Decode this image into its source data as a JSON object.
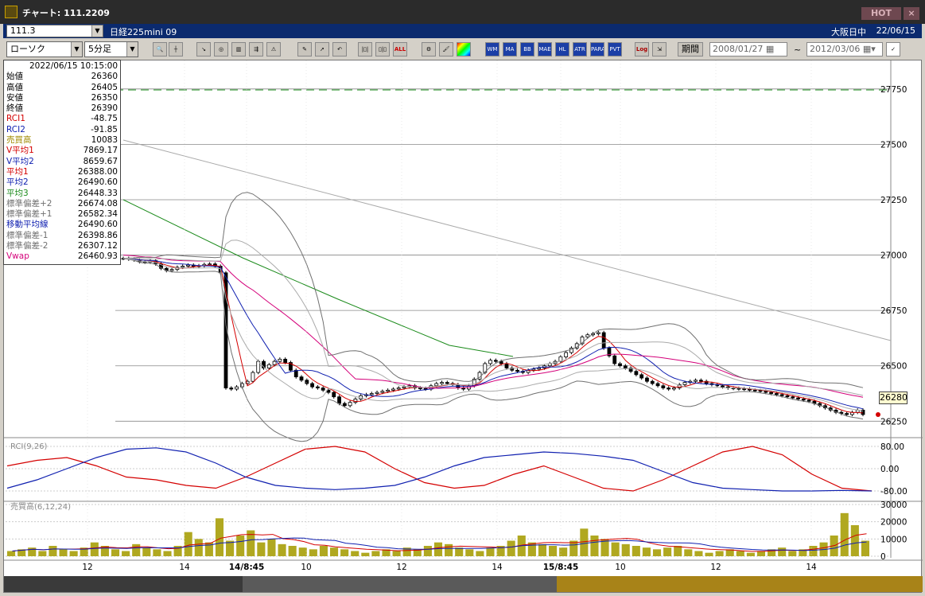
{
  "window": {
    "title": "チャート: 111.2209",
    "hot_label": "HOT"
  },
  "header": {
    "code": "111.3",
    "instrument": "日経225mini 09",
    "market": "大阪日中",
    "date": "22/06/15"
  },
  "toolbar": {
    "chart_type": "ローソク",
    "interval": "5分足",
    "buttons": [
      "zoom",
      "cursor",
      "draw-a",
      "draw-b",
      "draw-c",
      "draw-d",
      "draw-e",
      "pen",
      "arrow",
      "undo",
      "sep-a",
      "sep-b",
      "all",
      "gear",
      "brush",
      "palette",
      "WM",
      "MA",
      "BB",
      "MAE",
      "HL",
      "ATR",
      "PARA",
      "PVT",
      "Log",
      "export"
    ],
    "btn_labels": {
      "all": "ALL",
      "wm": "WM",
      "ma": "MA",
      "bb": "BB",
      "mae": "MAE",
      "hl": "HL",
      "atr": "ATR",
      "para": "PARA",
      "pvt": "PVT",
      "log": "Log"
    },
    "period_label": "期間",
    "date_from": "2008/01/27",
    "tilde": "~",
    "date_to": "2012/03/06"
  },
  "info": {
    "timestamp": "2022/06/15 10:15:00",
    "rows": [
      {
        "label": "始値",
        "value": "26360",
        "color": "#000000"
      },
      {
        "label": "高値",
        "value": "26405",
        "color": "#000000"
      },
      {
        "label": "安値",
        "value": "26350",
        "color": "#000000"
      },
      {
        "label": "終値",
        "value": "26390",
        "color": "#000000"
      },
      {
        "label": "RCI1",
        "value": "-48.75",
        "color": "#d40000"
      },
      {
        "label": "RCI2",
        "value": "-91.85",
        "color": "#1020b0"
      },
      {
        "label": "売買高",
        "value": "10083",
        "color": "#a08a00"
      },
      {
        "label": "V平均1",
        "value": "7869.17",
        "color": "#d40000"
      },
      {
        "label": "V平均2",
        "value": "8659.67",
        "color": "#1020b0"
      },
      {
        "label": "平均1",
        "value": "26388.00",
        "color": "#d40000"
      },
      {
        "label": "平均2",
        "value": "26490.60",
        "color": "#1020b0"
      },
      {
        "label": "平均3",
        "value": "26448.33",
        "color": "#1a8a1a"
      },
      {
        "label": "標準偏差+2",
        "value": "26674.08",
        "color": "#707070"
      },
      {
        "label": "標準偏差+1",
        "value": "26582.34",
        "color": "#707070"
      },
      {
        "label": "移動平均線",
        "value": "26490.60",
        "color": "#1020b0"
      },
      {
        "label": "標準偏差-1",
        "value": "26398.86",
        "color": "#707070"
      },
      {
        "label": "標準偏差-2",
        "value": "26307.12",
        "color": "#707070"
      },
      {
        "label": "Vwap",
        "value": "26460.93",
        "color": "#d4007a"
      }
    ]
  },
  "price_axis": {
    "ticks": [
      "27750",
      "27500",
      "27250",
      "27000",
      "26750",
      "26500",
      "26250"
    ]
  },
  "rci_axis": {
    "label": "RCI(9,26)",
    "ticks": [
      "80.00",
      "0.00",
      "-80.00"
    ]
  },
  "vol_axis": {
    "label": "売買高(6,12,24)",
    "ticks": [
      "30000",
      "20000",
      "10000",
      "0"
    ]
  },
  "time_axis": {
    "labels": [
      "12",
      "14",
      "14/8:45",
      "10",
      "12",
      "14",
      "15/8:45",
      "10",
      "12",
      "14"
    ]
  },
  "current_price": "26280",
  "colors": {
    "candle_up": "#ffffff",
    "candle_down": "#000000",
    "ma1": "#d40000",
    "ma2": "#1020b0",
    "ma3": "#1a8a1a",
    "bb": "#707070",
    "vwap": "#d4007a",
    "volume": "#b0a820"
  },
  "chart_data": {
    "type": "candlestick",
    "price_ylim": [
      26190,
      27850
    ],
    "candles_close": [
      26985,
      26982,
      26978,
      26970,
      26968,
      26975,
      26960,
      26940,
      26930,
      26935,
      26945,
      26950,
      26955,
      26948,
      26952,
      26958,
      26960,
      26950,
      26920,
      26400,
      26395,
      26405,
      26420,
      26430,
      26470,
      26520,
      26490,
      26505,
      26520,
      26530,
      26515,
      26480,
      26450,
      26435,
      26420,
      26405,
      26400,
      26390,
      26380,
      26360,
      26330,
      26320,
      26335,
      26350,
      26365,
      26370,
      26375,
      26380,
      26385,
      26390,
      26395,
      26400,
      26405,
      26410,
      26400,
      26398,
      26395,
      26410,
      26420,
      26425,
      26420,
      26415,
      26400,
      26395,
      26410,
      26440,
      26470,
      26510,
      26525,
      26520,
      26510,
      26490,
      26480,
      26475,
      26470,
      26480,
      26485,
      26490,
      26500,
      26510,
      26520,
      26540,
      26560,
      26580,
      26600,
      26630,
      26640,
      26645,
      26650,
      26580,
      26545,
      26510,
      26500,
      26490,
      26475,
      26460,
      26445,
      26430,
      26420,
      26410,
      26400,
      26395,
      26400,
      26415,
      26425,
      26430,
      26435,
      26430,
      26420,
      26415,
      26410,
      26405,
      26400,
      26398,
      26396,
      26395,
      26390,
      26388,
      26385,
      26380,
      26375,
      26370,
      26365,
      26360,
      26355,
      26350,
      26345,
      26340,
      26330,
      26320,
      26310,
      26300,
      26290,
      26285,
      26280,
      26290,
      26300,
      26280
    ],
    "rci1": [
      10,
      30,
      40,
      10,
      -30,
      -40,
      -60,
      -70,
      -30,
      20,
      70,
      80,
      60,
      0,
      -50,
      -70,
      -60,
      -20,
      10,
      -30,
      -70,
      -80,
      -40,
      10,
      60,
      80,
      50,
      -20,
      -70,
      -80
    ],
    "rci2": [
      -70,
      -40,
      0,
      40,
      70,
      75,
      60,
      20,
      -30,
      -60,
      -70,
      -75,
      -70,
      -60,
      -30,
      10,
      40,
      50,
      60,
      55,
      45,
      30,
      -10,
      -50,
      -70,
      -75,
      -80,
      -80,
      -78,
      -80
    ],
    "volume": [
      3,
      4,
      5,
      3,
      6,
      4,
      3,
      5,
      8,
      6,
      4,
      3,
      7,
      5,
      4,
      3,
      6,
      14,
      10,
      8,
      22,
      9,
      12,
      15,
      8,
      10,
      7,
      6,
      5,
      4,
      6,
      5,
      4,
      3,
      2,
      3,
      4,
      3,
      5,
      4,
      6,
      8,
      7,
      5,
      4,
      3,
      5,
      6,
      9,
      12,
      8,
      7,
      6,
      5,
      9,
      16,
      12,
      10,
      8,
      7,
      6,
      5,
      4,
      5,
      6,
      4,
      3,
      2,
      3,
      4,
      3,
      2,
      3,
      4,
      5,
      3,
      4,
      6,
      8,
      12,
      25,
      18,
      9
    ]
  }
}
